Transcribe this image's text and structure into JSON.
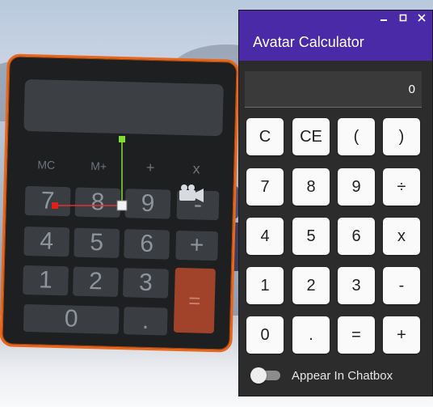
{
  "window": {
    "title": "Avatar Calculator",
    "controls": [
      "minimize",
      "maximize",
      "close"
    ]
  },
  "display": {
    "value": "0"
  },
  "keys": [
    [
      "C",
      "CE",
      "(",
      ")"
    ],
    [
      "7",
      "8",
      "9",
      "÷"
    ],
    [
      "4",
      "5",
      "6",
      "x"
    ],
    [
      "1",
      "2",
      "3",
      "-"
    ],
    [
      "0",
      ".",
      "=",
      "+"
    ]
  ],
  "chatbox_toggle": {
    "label": "Appear In Chatbox",
    "on": false
  },
  "scene_calculator": {
    "memory_keys": [
      "MC",
      "M+",
      "+",
      "x"
    ],
    "keys": [
      [
        "7",
        "8",
        "9",
        "-"
      ],
      [
        "4",
        "5",
        "6",
        "+"
      ],
      [
        "1",
        "2",
        "3",
        "="
      ],
      [
        "0",
        "."
      ]
    ]
  },
  "colors": {
    "accent": "#4a2aa6",
    "window_bg": "#2c2c2c",
    "key_bg": "#fafafa",
    "scene_frame": "#e8671d",
    "scene_equals": "#a1432a"
  }
}
